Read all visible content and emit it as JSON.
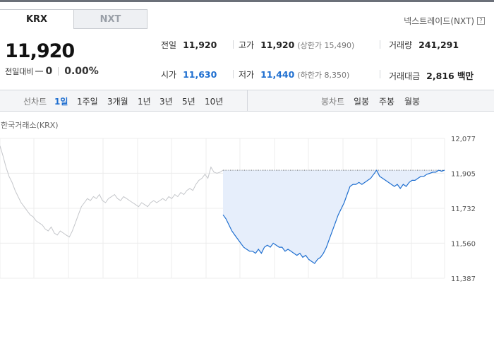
{
  "tabs": [
    {
      "label": "KRX"
    },
    {
      "label": "NXT"
    }
  ],
  "nxt_link": {
    "label": "넥스트레이드(NXT)",
    "icon": "?"
  },
  "quote": {
    "price": "11,920",
    "change_label": "전일대비",
    "change_value": "0",
    "change_pct": "0.00%"
  },
  "stats": {
    "prev_close": {
      "label": "전일",
      "value": "11,920"
    },
    "high": {
      "label": "고가",
      "value": "11,920",
      "sub": "(상한가 15,490)"
    },
    "volume": {
      "label": "거래량",
      "value": "241,291"
    },
    "open": {
      "label": "시가",
      "value": "11,630"
    },
    "low": {
      "label": "저가",
      "value": "11,440",
      "sub": "(하한가 8,350)"
    },
    "amount": {
      "label": "거래대금",
      "value": "2,816 백만"
    }
  },
  "toolbar": {
    "line_label": "선차트",
    "ranges": [
      "1일",
      "1주일",
      "3개월",
      "1년",
      "3년",
      "5년",
      "10년"
    ],
    "active_range": "1일",
    "candle_label": "봉차트",
    "candles": [
      "일봉",
      "주봉",
      "월봉"
    ]
  },
  "chart_source": "한국거래소(KRX)",
  "colors": {
    "accent": "#1f6fd0",
    "prev_line": "#c4c6ca",
    "area_fill": "#e6eefb"
  },
  "chart_data": {
    "type": "area",
    "ylim": [
      11387,
      12077
    ],
    "y_ticks": [
      "12,077",
      "11,905",
      "11,732",
      "11,560",
      "11,387"
    ],
    "y_tick_values": [
      12077,
      11905,
      11732,
      11560,
      11387
    ],
    "reference_value": 11920,
    "series": [
      {
        "values": [
          12040,
          11990,
          11935,
          11890,
          11860,
          11820,
          11790,
          11760,
          11740,
          11720,
          11700,
          11690,
          11670,
          11660,
          11650,
          11630,
          11620,
          11640,
          11610,
          11600,
          11620,
          11610,
          11600,
          11590,
          11620,
          11660,
          11700,
          11740,
          11760,
          11780,
          11770,
          11790,
          11780,
          11800,
          11770,
          11760,
          11780,
          11790,
          11800,
          11780,
          11770,
          11790,
          11780,
          11770,
          11760,
          11750,
          11740,
          11760,
          11750,
          11740,
          11760,
          11770,
          11760,
          11770,
          11780,
          11770,
          11790,
          11780,
          11800,
          11790,
          11810,
          11800,
          11820,
          11830,
          11820,
          11850,
          11870,
          11880,
          11900,
          11880,
          11935,
          11910,
          11905,
          11910,
          11920
        ]
      },
      {
        "values": [
          11700,
          11680,
          11650,
          11620,
          11600,
          11580,
          11560,
          11540,
          11530,
          11520,
          11520,
          11510,
          11530,
          11510,
          11540,
          11550,
          11540,
          11560,
          11550,
          11540,
          11540,
          11520,
          11530,
          11520,
          11510,
          11500,
          11510,
          11490,
          11500,
          11480,
          11470,
          11460,
          11480,
          11490,
          11510,
          11540,
          11580,
          11620,
          11660,
          11700,
          11730,
          11760,
          11800,
          11840,
          11850,
          11850,
          11860,
          11850,
          11860,
          11870,
          11880,
          11900,
          11920,
          11890,
          11880,
          11870,
          11860,
          11850,
          11840,
          11850,
          11830,
          11850,
          11840,
          11860,
          11870,
          11870,
          11880,
          11890,
          11890,
          11900,
          11905,
          11910,
          11910,
          11920,
          11915,
          11920
        ]
      }
    ]
  }
}
